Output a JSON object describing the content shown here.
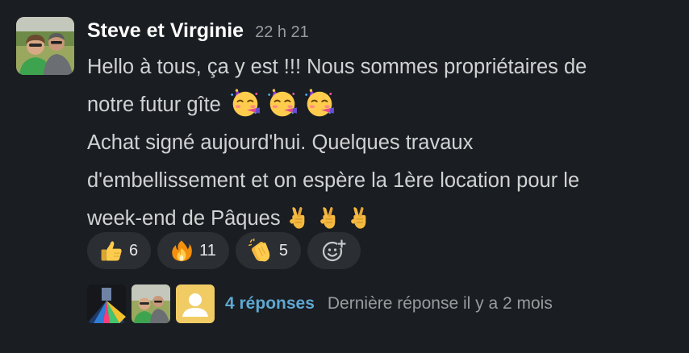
{
  "message": {
    "author": "Steve et Virginie",
    "time": "22 h 21",
    "lines": [
      "Hello à tous, ça y est !!! Nous sommes propriétaires de",
      "notre futur gîte",
      "Achat signé aujourd'hui. Quelques travaux",
      "d'embellissement et on espère la 1ère location pour le",
      "week-end de Pâques"
    ],
    "inline_emojis": {
      "line2": [
        "partying-face",
        "partying-face",
        "partying-face"
      ],
      "line5": [
        "crossed-fingers",
        "crossed-fingers",
        "crossed-fingers"
      ]
    }
  },
  "reactions": [
    {
      "emoji": "thumbs-up",
      "count": "6"
    },
    {
      "emoji": "fire",
      "count": "11"
    },
    {
      "emoji": "clapping-hands",
      "count": "5"
    }
  ],
  "add_reaction_icon": "add-emoji-icon",
  "thread": {
    "replies_label": "4 réponses",
    "last_reply": "Dernière réponse il y a 2 mois"
  },
  "colors": {
    "background": "#1a1d21",
    "author": "#ffffff",
    "text": "#d1d2d3",
    "muted": "#9a9b9d",
    "link": "#5fa8d3",
    "reaction_bg": "#2b2e33"
  }
}
